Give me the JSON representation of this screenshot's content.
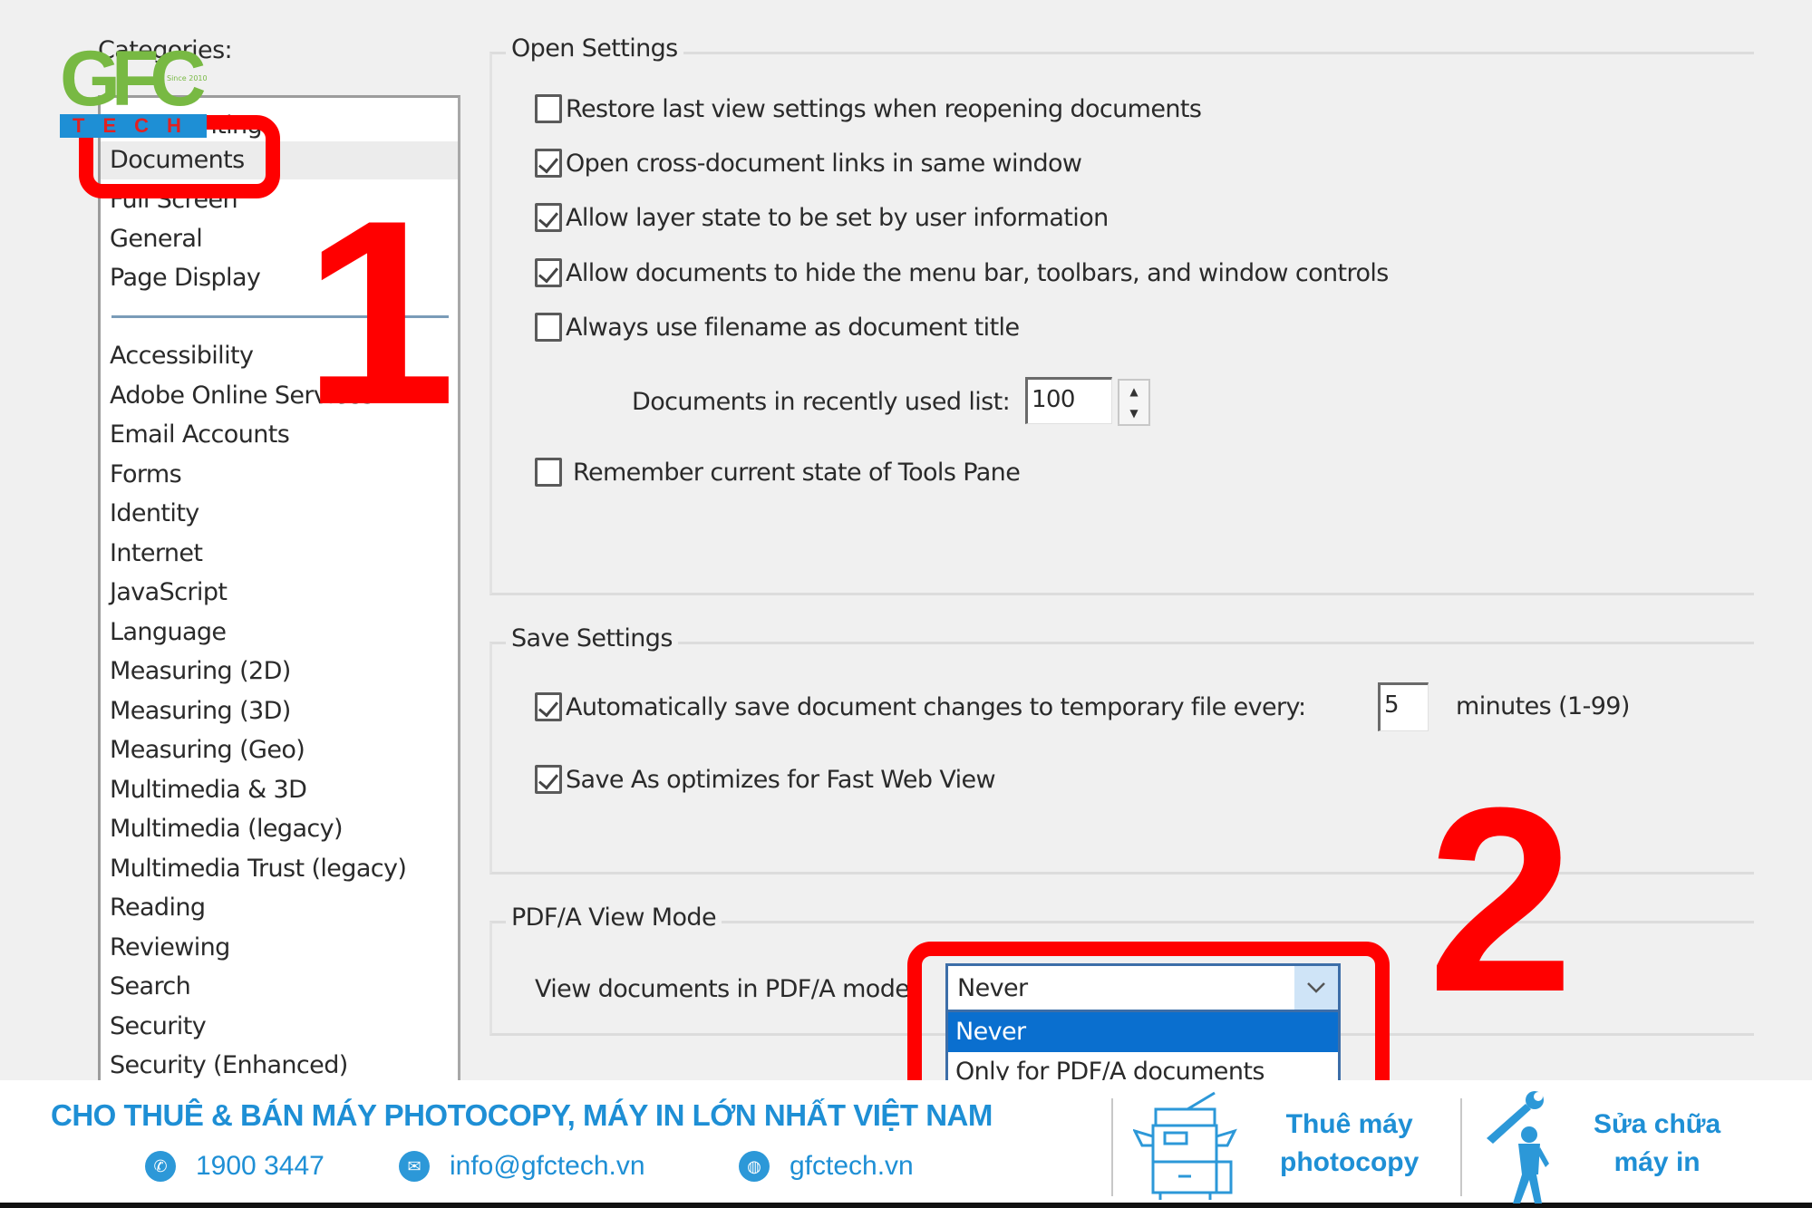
{
  "sidebar": {
    "label": "Categories:",
    "items_top": [
      {
        "label": "Commenting"
      },
      {
        "label": "Documents",
        "selected": true
      },
      {
        "label": "Full Screen"
      },
      {
        "label": "General"
      },
      {
        "label": "Page Display"
      }
    ],
    "items": [
      {
        "label": "Accessibility"
      },
      {
        "label": "Adobe Online Services"
      },
      {
        "label": "Email Accounts"
      },
      {
        "label": "Forms"
      },
      {
        "label": "Identity"
      },
      {
        "label": "Internet"
      },
      {
        "label": "JavaScript"
      },
      {
        "label": "Language"
      },
      {
        "label": "Measuring (2D)"
      },
      {
        "label": "Measuring (3D)"
      },
      {
        "label": "Measuring (Geo)"
      },
      {
        "label": "Multimedia & 3D"
      },
      {
        "label": "Multimedia (legacy)"
      },
      {
        "label": "Multimedia Trust (legacy)"
      },
      {
        "label": "Reading"
      },
      {
        "label": "Reviewing"
      },
      {
        "label": "Search"
      },
      {
        "label": "Security"
      },
      {
        "label": "Security (Enhanced)"
      }
    ]
  },
  "open_settings": {
    "title": "Open Settings",
    "options": [
      {
        "label": "Restore last view settings when reopening documents",
        "checked": false
      },
      {
        "label": "Open cross-document links in same window",
        "checked": true
      },
      {
        "label": "Allow layer state to be set by user information",
        "checked": true
      },
      {
        "label": "Allow documents to hide the menu bar, toolbars, and window controls",
        "checked": true
      },
      {
        "label": "Always use filename as document title",
        "checked": false
      }
    ],
    "recent_list_label": "Documents in recently used list:",
    "recent_list_value": "100",
    "remember_tools": {
      "label": "Remember current state of Tools Pane",
      "checked": false
    }
  },
  "save_settings": {
    "title": "Save Settings",
    "autosave": {
      "label": "Automatically save document changes to temporary file every:",
      "checked": true,
      "value": "5",
      "unit": "minutes (1-99)"
    },
    "fast_web": {
      "label": "Save As optimizes for Fast Web View",
      "checked": true
    }
  },
  "pdfa_view_mode": {
    "title": "PDF/A View Mode",
    "label": "View documents in PDF/A mode",
    "selected": "Never",
    "options": [
      "Never",
      "Only for PDF/A documents"
    ]
  },
  "annotations": {
    "step1": "1",
    "step2": "2",
    "color": "#ff0000"
  },
  "logo": {
    "brand": "GFC",
    "sub": "TECH",
    "since": "Since 2010"
  },
  "footer": {
    "headline": "CHO THUÊ & BÁN MÁY PHOTOCOPY, MÁY IN LỚN NHẤT VIỆT NAM",
    "phone": "1900 3447",
    "email": "info@gfctech.vn",
    "website": "gfctech.vn",
    "service1": [
      "Thuê máy",
      "photocopy"
    ],
    "service2": [
      "Sửa chữa",
      "máy in"
    ],
    "accent": "#1e8fd5"
  }
}
